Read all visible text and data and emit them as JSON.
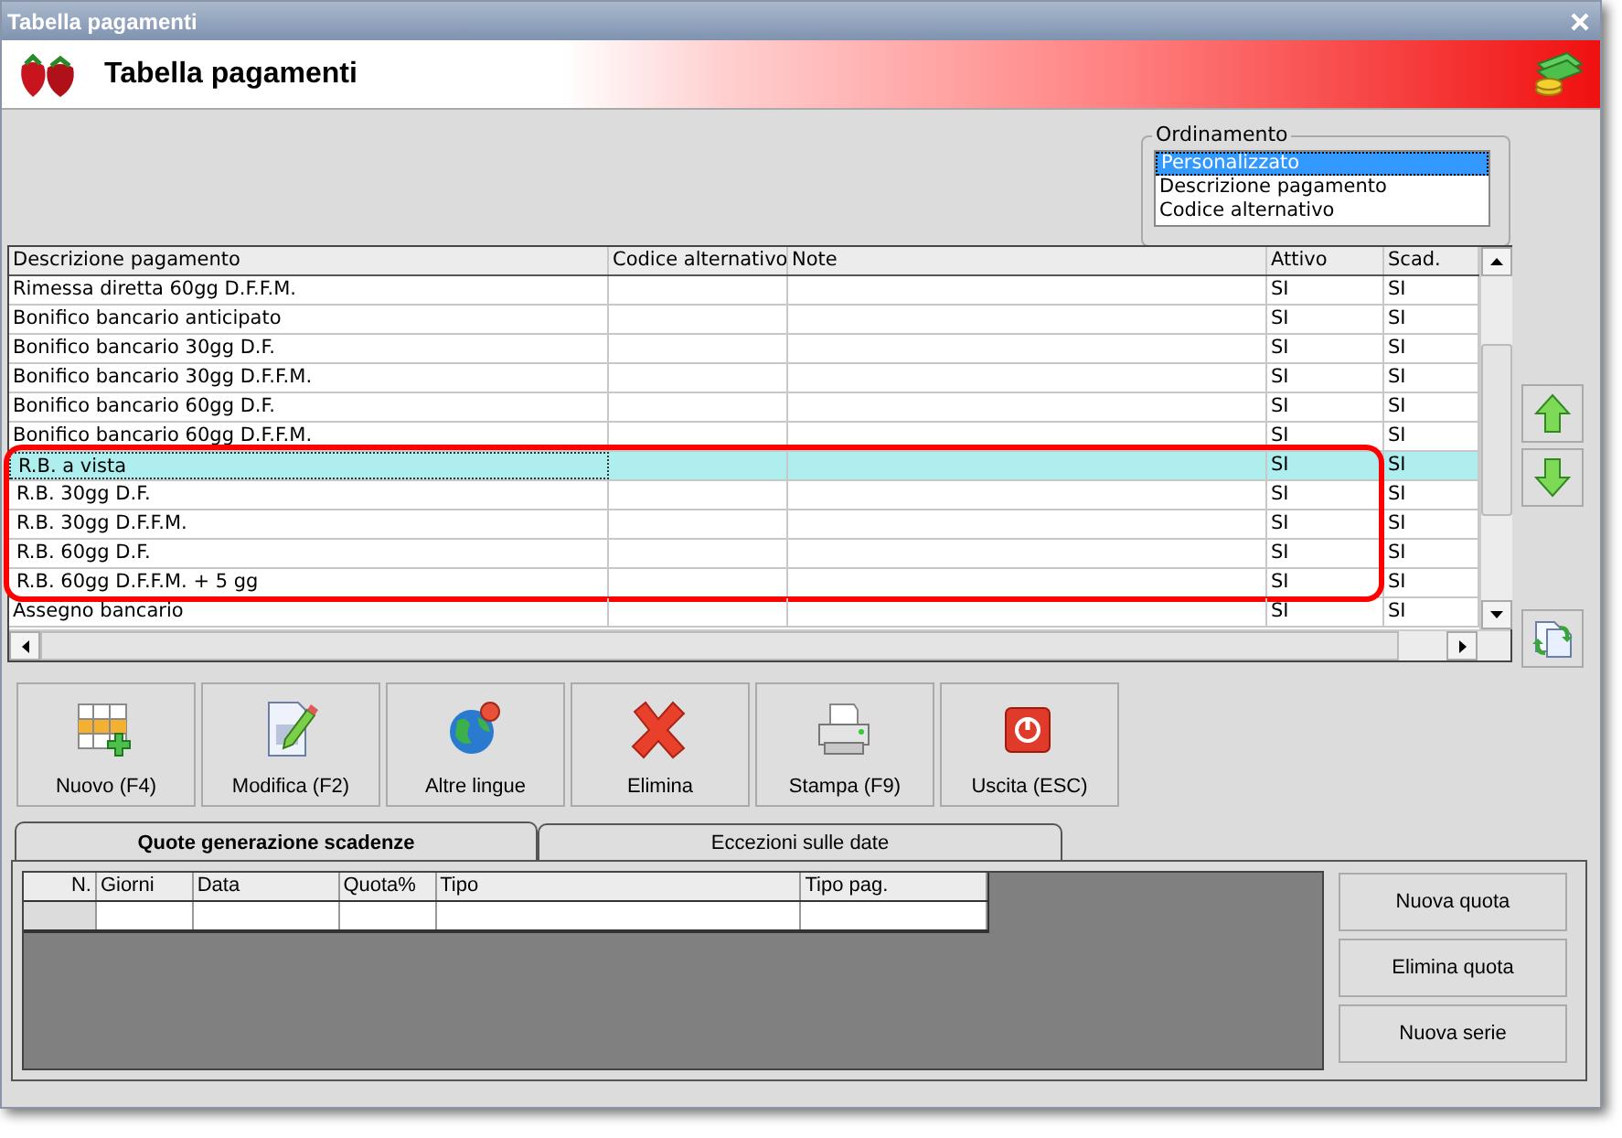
{
  "window": {
    "title": "Tabella pagamenti"
  },
  "header": {
    "title": "Tabella pagamenti"
  },
  "ordering": {
    "label": "Ordinamento",
    "options": [
      {
        "label": "Personalizzato",
        "selected": true
      },
      {
        "label": "Descrizione pagamento",
        "selected": false
      },
      {
        "label": "Codice alternativo",
        "selected": false
      }
    ]
  },
  "table": {
    "columns": [
      "Descrizione pagamento",
      "Codice alternativo",
      "Note",
      "Attivo",
      "Scad."
    ],
    "rows": [
      {
        "cells": [
          "Rimessa diretta 60gg D.F.F.M.",
          "",
          "",
          "SI",
          "SI"
        ],
        "selected": false,
        "highlighted": false
      },
      {
        "cells": [
          "Bonifico bancario anticipato",
          "",
          "",
          "SI",
          "SI"
        ],
        "selected": false,
        "highlighted": false
      },
      {
        "cells": [
          "Bonifico bancario 30gg D.F.",
          "",
          "",
          "SI",
          "SI"
        ],
        "selected": false,
        "highlighted": false
      },
      {
        "cells": [
          "Bonifico bancario 30gg D.F.F.M.",
          "",
          "",
          "SI",
          "SI"
        ],
        "selected": false,
        "highlighted": false
      },
      {
        "cells": [
          "Bonifico bancario 60gg D.F.",
          "",
          "",
          "SI",
          "SI"
        ],
        "selected": false,
        "highlighted": false
      },
      {
        "cells": [
          "Bonifico bancario 60gg D.F.F.M.",
          "",
          "",
          "SI",
          "SI"
        ],
        "selected": false,
        "highlighted": false
      },
      {
        "cells": [
          "R.B. a vista",
          "",
          "",
          "SI",
          "SI"
        ],
        "selected": true,
        "highlighted": true
      },
      {
        "cells": [
          "R.B. 30gg D.F.",
          "",
          "",
          "SI",
          "SI"
        ],
        "selected": false,
        "highlighted": true
      },
      {
        "cells": [
          "R.B. 30gg D.F.F.M.",
          "",
          "",
          "SI",
          "SI"
        ],
        "selected": false,
        "highlighted": true
      },
      {
        "cells": [
          "R.B. 60gg D.F.",
          "",
          "",
          "SI",
          "SI"
        ],
        "selected": false,
        "highlighted": true
      },
      {
        "cells": [
          "R.B. 60gg D.F.F.M.  + 5 gg",
          "",
          "",
          "SI",
          "SI"
        ],
        "selected": false,
        "highlighted": true
      },
      {
        "cells": [
          "Assegno bancario",
          "",
          "",
          "SI",
          "SI"
        ],
        "selected": false,
        "highlighted": false
      }
    ]
  },
  "toolbar": [
    "Nuovo (F4)",
    "Modifica (F2)",
    "Altre lingue",
    "Elimina",
    "Stampa (F9)",
    "Uscita (ESC)"
  ],
  "tabs": [
    {
      "label": "Quote generazione scadenze",
      "selected": true
    },
    {
      "label": "Eccezioni sulle date",
      "selected": false
    }
  ],
  "quotes": {
    "columns": [
      "N.",
      "Giorni",
      "Data",
      "Quota%",
      "Tipo",
      "Tipo pag."
    ]
  },
  "quote_buttons": [
    "Nuova quota",
    "Elimina quota",
    "Nuova serie"
  ]
}
